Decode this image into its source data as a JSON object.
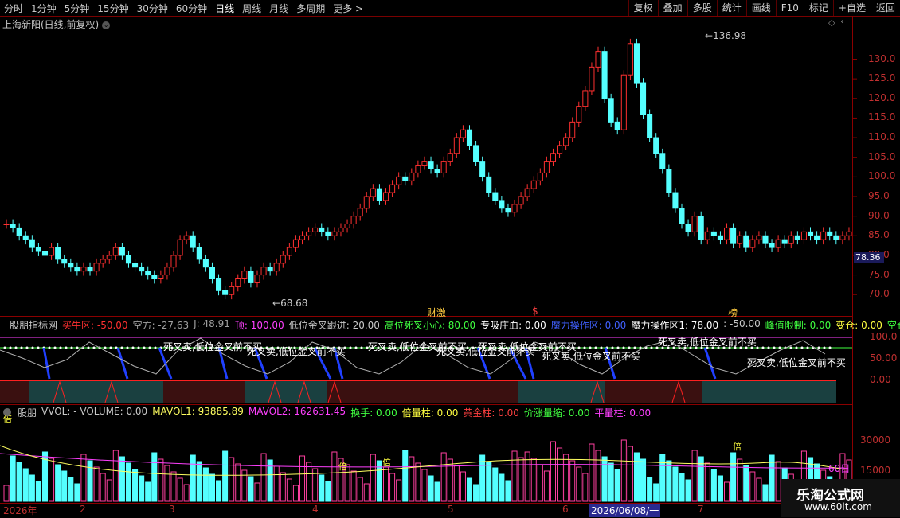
{
  "toolbar": {
    "periods": [
      "分时",
      "1分钟",
      "5分钟",
      "15分钟",
      "30分钟",
      "60分钟",
      "日线",
      "周线",
      "月线",
      "多周期",
      "更多 >"
    ],
    "active_period": "日线",
    "actions": [
      "复权",
      "叠加",
      "多股",
      "统计",
      "画线",
      "F10",
      "标记",
      "+自选",
      "返回"
    ]
  },
  "chart_title": "上海新阳(日线,前复权)",
  "price_axis": {
    "ticks": [
      "130.0",
      "125.0",
      "120.0",
      "115.0",
      "110.0",
      "105.0",
      "100.0",
      "95.0",
      "90.0",
      "85.0",
      "80.0",
      "75.0",
      "70.0"
    ],
    "tick_values": [
      130,
      125,
      120,
      115,
      110,
      105,
      100,
      95,
      90,
      85,
      80,
      75,
      70
    ],
    "current_price": "78.36",
    "high_label": "136.98",
    "low_label": "68.68"
  },
  "event_markers": [
    "财激",
    "$",
    "榜"
  ],
  "indicator1": {
    "name": "股朋指标网",
    "items": [
      {
        "text": "买牛区: -50.00",
        "color": "#ff3030"
      },
      {
        "text": "空方: -27.63",
        "color": "#a0a0a0"
      },
      {
        "text": "J: 48.91",
        "color": "#a0a0a0"
      },
      {
        "text": "顶: 100.00",
        "color": "#ff40ff"
      },
      {
        "text": "低位金叉跟进: 20.00",
        "color": "#c8c8c8"
      },
      {
        "text": "高位死叉小心: 80.00",
        "color": "#40ff40"
      },
      {
        "text": "专吸庄血: 0.00",
        "color": "#ffffff"
      },
      {
        "text": "魔力操作区: 0.00",
        "color": "#4060ff"
      },
      {
        "text": "魔力操作区1: 78.00",
        "color": "#ffffff"
      },
      {
        "text": ": -50.00",
        "color": "#c8c8c8"
      },
      {
        "text": "峰值限制: 0.00",
        "color": "#40ff40"
      },
      {
        "text": "变仓: 0.00",
        "color": "#ffff40"
      },
      {
        "text": "空仓",
        "color": "#40ff40"
      }
    ],
    "ticks": [
      "100.0",
      "50.00",
      "0.00"
    ],
    "annotation": "死叉卖,低位金叉前不买"
  },
  "indicator2": {
    "name": "股朋",
    "items": [
      {
        "text": "VVOL: - VOLUME: 0.00",
        "color": "#c8c8c8"
      },
      {
        "text": "MAVOL1: 93885.89",
        "color": "#ffff60"
      },
      {
        "text": "MAVOL2: 162631.45",
        "color": "#ff40ff"
      },
      {
        "text": "换手: 0.00",
        "color": "#40ff40"
      },
      {
        "text": "倍量柱: 0.00",
        "color": "#ffff40"
      },
      {
        "text": "黄金柱: 0.00",
        "color": "#ff4040"
      },
      {
        "text": "价涨量缩: 0.00",
        "color": "#40ff40"
      },
      {
        "text": "平量柱: 0.00",
        "color": "#ff40ff"
      }
    ],
    "ticks": [
      "30000",
      "15000"
    ],
    "ma_label": "60日",
    "bei_label": "倍"
  },
  "date_axis": [
    "2026年",
    "2",
    "3",
    "4",
    "5",
    "6",
    "7"
  ],
  "date_highlight": "2026/06/08/一",
  "logo": {
    "line1": "乐淘公式网",
    "line2": "www.60lt.com"
  },
  "colors": {
    "up": "#ff3030",
    "down": "#54ffff",
    "panel_border": "#8b0000",
    "bg": "#000000"
  }
}
